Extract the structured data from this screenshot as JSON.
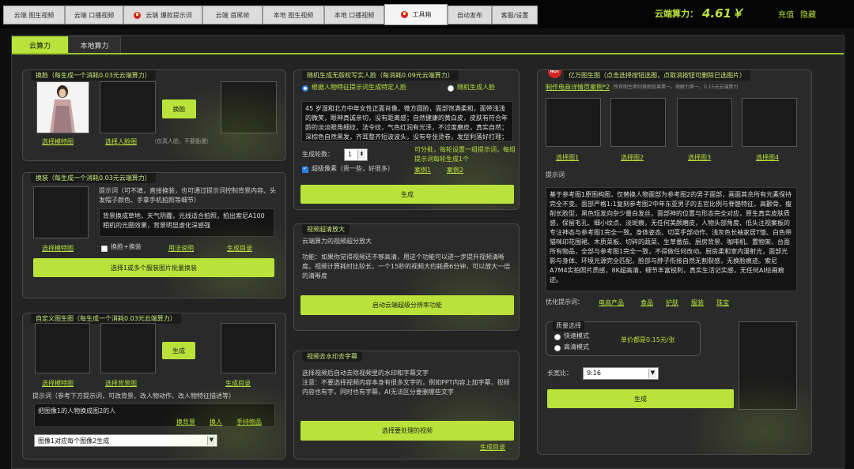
{
  "topbar": {
    "tabs": [
      "云端 图生视频",
      "云端 口播视频",
      "云端 爆款提示词",
      "云端 首尾帧",
      "本地 图生视频",
      "本地 口播视频",
      "工具箱",
      "自动发布",
      "客服/设置"
    ],
    "active_tab": "工具箱",
    "balance_label": "云端算力：",
    "balance_value": "4.61￥",
    "recharge": "充值",
    "hide": "隐藏"
  },
  "subtabs": {
    "cloud": "云算力",
    "local": "本地算力"
  },
  "faceswap": {
    "title": "换脸（每生成一个消耗0.03元云端算力）",
    "button": "换脸",
    "select_model": "选择模特图",
    "select_face": "选择人脸图",
    "note": "（仅真人脸，不要動漫）"
  },
  "outfit": {
    "title": "换装（每生成一个消耗0.03元云端算力）",
    "prompt_label": "提示词（可不填，直接换装，也可通过提示词控制背景内容、头发帽子颜色、手拿手机拍照等细节）",
    "prompt_value": "背景换成草地，天气阴霾，光线适合拍照，拍出索尼A100相机的光圈效果，背景明显虚化深感强",
    "select_model": "选择模特图",
    "swap_label": "换脸+换装",
    "usage": "用法说明",
    "output_dir": "生成目录",
    "batch_button": "选择1或多个服装图片批量换装"
  },
  "custom": {
    "title": "自定义图生图（每生成一个消耗0.03元云端算力）",
    "button": "生成",
    "select_model": "选择模特图",
    "select_bg": "选择背景图",
    "output_dir": "生成目录",
    "prompt_label": "提示词（参考下方提示词，可改背景、改人物动作、改人物特征描述等）",
    "prompt_value": "把图像1的人物换成图2的人",
    "tags": [
      "换背景",
      "换人",
      "手持物品"
    ],
    "mode": "图像1对应每个图像2生成"
  },
  "random_face": {
    "title": "随机生成无版权写实人脸（每消耗0.09元云端算力）",
    "opt1": "根据人物特征提示词生成特定人脸",
    "opt2": "随机生成人脸",
    "desc": "45 岁湿和北方中年女性正面肖像，微方圆脸，面部饱满柔和，面带浅浅的微笑，眼神真诚亲切，没有距离感；自然健康的黄白皮，皮肤有符合年龄的淡淡眼角细纹，法令纹，气色红润有光泽，不过度磨皮，真实自然；深棕色自然黑发，齐耳整齐短波波头，没有夸张烫卷，发型利落好打理；自然弯眉",
    "rounds_label": "生成轮数：",
    "rounds_value": "1",
    "hint": "可分批，每轮设置一组提示词，每组提示词每轮生成1个",
    "hd_label": "超级像素（贵一些，好很多）",
    "case1": "案例1",
    "case2": "案例2",
    "button": "生成"
  },
  "upscale": {
    "title": "视频超清放大",
    "sub": "云端算力的视频超分放大",
    "desc": "功能：如果你觉得视频还不够高清，用这个功能可以进一步提升视频清晰度。视频计算耗时比较长，一个15秒的视频大约耗费6分钟，可以放大一倍的清晰度",
    "button": "启动云端超级分辨率功能"
  },
  "watermark": {
    "title": "视频去水印去字幕",
    "desc": "选择视频后自动去除视频里的水印和字幕文字\n注意：不要选择视频内容本身有很多文字的，例如PPT内容上加字幕，视频内容也有字，同时也有字幕，AI无法区分要删哪些文字",
    "button": "选择要处理的视频",
    "output_dir": "生成目录"
  },
  "billion": {
    "hot": "HOT",
    "title": "亿万图生图（点击选择按钮选图，点取消按钮可删除已选图片）",
    "link": "制作电商详情页案例*2",
    "subnote": "所有图生图切换图效果第一，理解力第一，0.15元云端算力",
    "pick": [
      "选择图1",
      "选择图2",
      "选择图3",
      "选择图4"
    ],
    "prompt_label": "提示词",
    "prompt_value": "基于参考图1原图构图，仅替换人物面部为参考图2的男子面部，画面其余所有元素保持完全不变。面部严格1:1复刻参考图2中年东亚男子的五官比例与脊骼特征，高颧骨，瘦削长脸型，黑色短发向杂少量白发丝，面部神的位置与形态完全对应，原生真实皮肤质感，保留毛孔、细小纹点、淡斑痕，无任何美颜磨皮，人物头部角度、低头注视案板的专注神态与参考图1完全一致。身体姿态、切菜手部动作、浅灰色长袖家居T恤、白色带猫咪印花围裙、木质菜板、切碎的蔬菜、生草番茄、厨房背景、咖啡机、置物架、台面所有物品，全部与参考图1完全一致，不得做任何改动。厨房柔和室内漫射光，面部光影与身体、环境光源完全匹配，脸部与脖子衔接自然无割裂感，无换脸痕迹。索尼A7M4实拍照片质感，8K超高清，细节丰富锐利，真实生活记实感，无任何AI绘画痕迹。",
    "optimize_label": "优化提示词：",
    "opt_tags": [
      "电商产品",
      "食品",
      "护肤",
      "服装",
      "珠宝"
    ],
    "quality_title": "质量选择",
    "q_fast": "快速模式",
    "q_hd": "高清模式",
    "unit_price": "单价都是0.15元/张",
    "ratio_label": "长宽比：",
    "ratio_value": "9:16",
    "button": "生成"
  }
}
